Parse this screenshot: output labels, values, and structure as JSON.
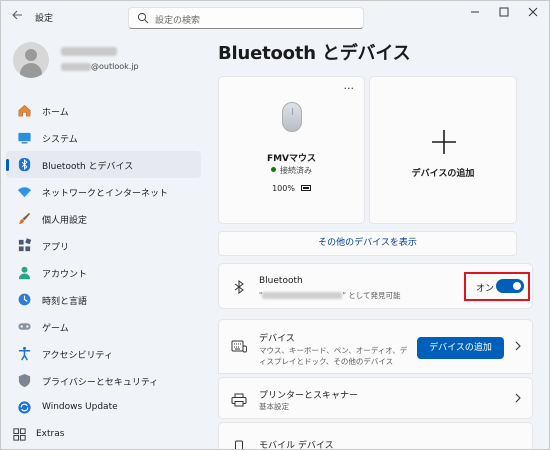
{
  "window": {
    "title": "設定"
  },
  "search": {
    "placeholder": "設定の検索"
  },
  "account": {
    "email_suffix": "@outlook.jp"
  },
  "sidebar": {
    "items": [
      {
        "label": "ホーム",
        "icon": "home-icon"
      },
      {
        "label": "システム",
        "icon": "system-icon"
      },
      {
        "label": "Bluetooth とデバイス",
        "icon": "bluetooth-icon",
        "active": true
      },
      {
        "label": "ネットワークとインターネット",
        "icon": "network-icon"
      },
      {
        "label": "個人用設定",
        "icon": "personalization-icon"
      },
      {
        "label": "アプリ",
        "icon": "apps-icon"
      },
      {
        "label": "アカウント",
        "icon": "accounts-icon"
      },
      {
        "label": "時刻と言語",
        "icon": "time-language-icon"
      },
      {
        "label": "ゲーム",
        "icon": "gaming-icon"
      },
      {
        "label": "アクセシビリティ",
        "icon": "accessibility-icon"
      },
      {
        "label": "プライバシーとセキュリティ",
        "icon": "privacy-security-icon"
      },
      {
        "label": "Windows Update",
        "icon": "windows-update-icon"
      },
      {
        "label": "Extras",
        "icon": "extras-icon"
      }
    ]
  },
  "main": {
    "title": "Bluetooth とデバイス",
    "device": {
      "name": "FMVマウス",
      "status": "接続済み",
      "battery": "100%",
      "more": "···"
    },
    "add_device_card": {
      "label": "デバイスの追加"
    },
    "show_more": "その他のデバイスを表示",
    "bluetooth": {
      "title": "Bluetooth",
      "sub_prefix": "\"",
      "sub_suffix": "\" として発見可能",
      "toggle_label": "オン",
      "on": true
    },
    "devices": {
      "title": "デバイス",
      "sub": "マウス、キーボード、ペン、オーディオ、ディスプレイとドック、その他のデバイス",
      "button": "デバイスの追加"
    },
    "printers": {
      "title": "プリンターとスキャナー",
      "sub": "基本設定"
    },
    "mobile": {
      "title": "モバイル デバイス"
    }
  },
  "colors": {
    "accent": "#005fb8",
    "highlight": "#e0141e",
    "connected": "#0f7b0f"
  }
}
